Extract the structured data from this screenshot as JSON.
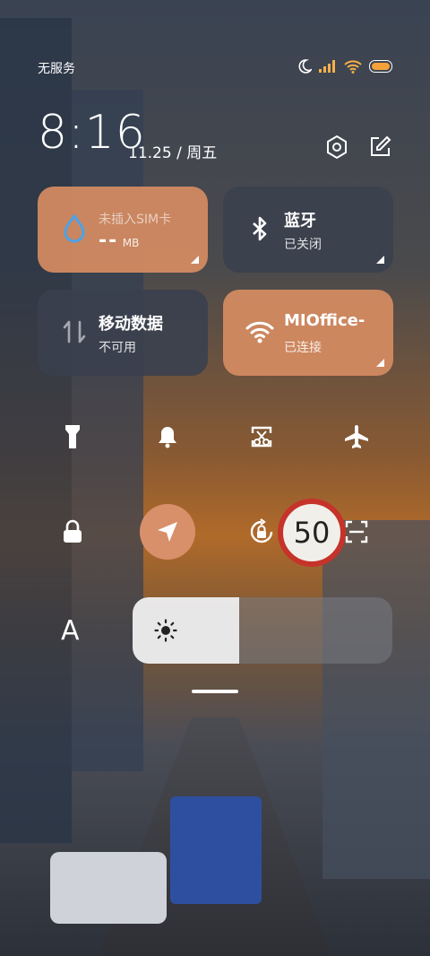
{
  "status_bar": {
    "carrier": "无服务",
    "icons": [
      "moon-icon",
      "signal-icon",
      "wifi-icon",
      "battery-icon"
    ]
  },
  "header": {
    "time": "8:16",
    "date": "11.25 / 周五",
    "actions": [
      "settings-icon",
      "edit-icon"
    ]
  },
  "tiles": {
    "sim": {
      "title": "未插入SIM卡",
      "value": "--",
      "unit": "MB",
      "icon": "water-drop-icon",
      "active": true
    },
    "bluetooth": {
      "title": "蓝牙",
      "subtitle": "已关闭",
      "icon": "bluetooth-icon",
      "active": false
    },
    "mobile_data": {
      "title": "移动数据",
      "subtitle": "不可用",
      "icon": "mobile-data-icon",
      "active": false
    },
    "wifi": {
      "title": "MIOffice-",
      "subtitle": "已连接",
      "icon": "wifi-icon",
      "active": true
    }
  },
  "quick_toggles": [
    {
      "name": "flashlight-icon",
      "active": false
    },
    {
      "name": "bell-icon",
      "active": false
    },
    {
      "name": "screenshot-icon",
      "active": false
    },
    {
      "name": "airplane-icon",
      "active": false
    },
    {
      "name": "lock-icon",
      "active": false
    },
    {
      "name": "location-icon",
      "active": true
    },
    {
      "name": "rotation-lock-icon",
      "active": false
    },
    {
      "name": "scan-icon",
      "active": false
    }
  ],
  "font_toggle": {
    "label": "A"
  },
  "brightness": {
    "level": 0.41,
    "icon": "sun-icon"
  },
  "colors": {
    "tile_on": "#d68c62",
    "tile_off": "#3a404e",
    "location_on": "#d8906a"
  }
}
